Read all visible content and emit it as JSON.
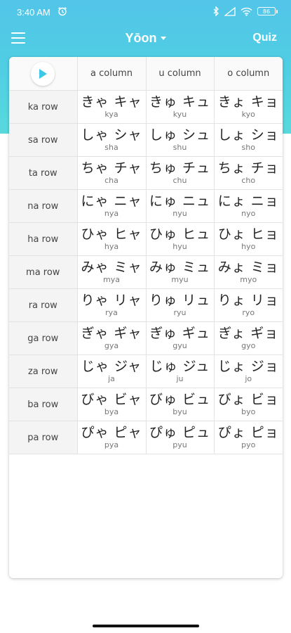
{
  "status_bar": {
    "time": "3:40 AM",
    "battery": "86"
  },
  "app_bar": {
    "title": "Yōon",
    "quiz_label": "Quiz"
  },
  "table": {
    "columns": [
      "a column",
      "u column",
      "o column"
    ],
    "rows": [
      {
        "label": "ka row",
        "cells": [
          {
            "kana": "きゃ キャ",
            "romaji": "kya"
          },
          {
            "kana": "きゅ キュ",
            "romaji": "kyu"
          },
          {
            "kana": "きょ キョ",
            "romaji": "kyo"
          }
        ]
      },
      {
        "label": "sa row",
        "cells": [
          {
            "kana": "しゃ シャ",
            "romaji": "sha"
          },
          {
            "kana": "しゅ シュ",
            "romaji": "shu"
          },
          {
            "kana": "しょ ショ",
            "romaji": "sho"
          }
        ]
      },
      {
        "label": "ta row",
        "cells": [
          {
            "kana": "ちゃ チャ",
            "romaji": "cha"
          },
          {
            "kana": "ちゅ チュ",
            "romaji": "chu"
          },
          {
            "kana": "ちょ チョ",
            "romaji": "cho"
          }
        ]
      },
      {
        "label": "na row",
        "cells": [
          {
            "kana": "にゃ ニャ",
            "romaji": "nya"
          },
          {
            "kana": "にゅ ニュ",
            "romaji": "nyu"
          },
          {
            "kana": "にょ ニョ",
            "romaji": "nyo"
          }
        ]
      },
      {
        "label": "ha row",
        "cells": [
          {
            "kana": "ひゃ ヒャ",
            "romaji": "hya"
          },
          {
            "kana": "ひゅ ヒュ",
            "romaji": "hyu"
          },
          {
            "kana": "ひょ ヒョ",
            "romaji": "hyo"
          }
        ]
      },
      {
        "label": "ma row",
        "cells": [
          {
            "kana": "みゃ ミャ",
            "romaji": "mya"
          },
          {
            "kana": "みゅ ミュ",
            "romaji": "myu"
          },
          {
            "kana": "みょ ミョ",
            "romaji": "myo"
          }
        ]
      },
      {
        "label": "ra row",
        "cells": [
          {
            "kana": "りゃ リャ",
            "romaji": "rya"
          },
          {
            "kana": "りゅ リュ",
            "romaji": "ryu"
          },
          {
            "kana": "りょ リョ",
            "romaji": "ryo"
          }
        ]
      },
      {
        "label": "ga row",
        "cells": [
          {
            "kana": "ぎゃ ギャ",
            "romaji": "gya"
          },
          {
            "kana": "ぎゅ ギュ",
            "romaji": "gyu"
          },
          {
            "kana": "ぎょ ギョ",
            "romaji": "gyo"
          }
        ]
      },
      {
        "label": "za row",
        "cells": [
          {
            "kana": "じゃ ジャ",
            "romaji": "ja"
          },
          {
            "kana": "じゅ ジュ",
            "romaji": "ju"
          },
          {
            "kana": "じょ ジョ",
            "romaji": "jo"
          }
        ]
      },
      {
        "label": "ba row",
        "cells": [
          {
            "kana": "びゃ ビャ",
            "romaji": "bya"
          },
          {
            "kana": "びゅ ビュ",
            "romaji": "byu"
          },
          {
            "kana": "びょ ビョ",
            "romaji": "byo"
          }
        ]
      },
      {
        "label": "pa row",
        "cells": [
          {
            "kana": "ぴゃ ピャ",
            "romaji": "pya"
          },
          {
            "kana": "ぴゅ ピュ",
            "romaji": "pyu"
          },
          {
            "kana": "ぴょ ピョ",
            "romaji": "pyo"
          }
        ]
      }
    ]
  },
  "icons": [
    "menu-icon",
    "dropdown-caret-icon",
    "play-icon",
    "bluetooth-icon",
    "wifi-icon",
    "signal-icon",
    "battery-icon",
    "alarm-icon"
  ],
  "colors": {
    "header_top": "#53c5e8",
    "header_bottom": "#59d9dc",
    "play_accent": "#3cc8e6"
  }
}
